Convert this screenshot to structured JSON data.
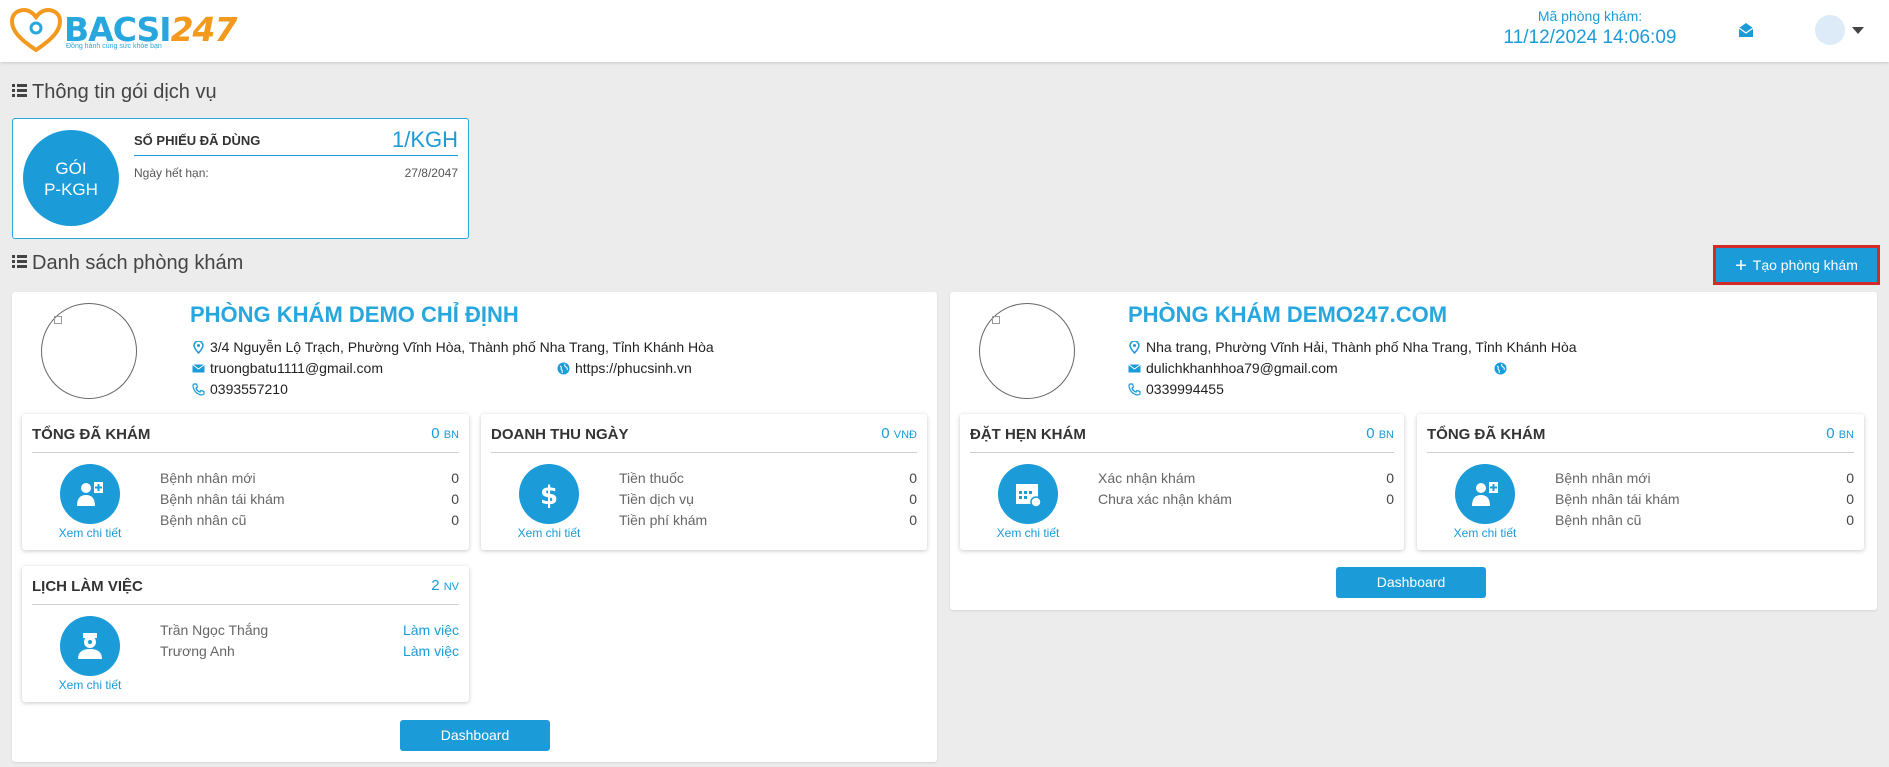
{
  "header": {
    "logo_main": "BACSI",
    "logo_num": "247",
    "logo_slogan": "Đồng hành cùng sức khỏe bạn",
    "clinic_code_label": "Mã phòng khám:",
    "datetime": "11/12/2024 14:06:09"
  },
  "package_section": {
    "title": "Thông tin gói dịch vụ",
    "badge_line1": "GÓI",
    "badge_line2": "P-KGH",
    "used_label": "SỐ PHIẾU ĐÃ DÙNG",
    "used_value": "1/KGH",
    "expiry_label": "Ngày hết hạn:",
    "expiry_value": "27/8/2047"
  },
  "clinic_section": {
    "title": "Danh sách phòng khám",
    "create_button": "Tạo phòng khám"
  },
  "clinics": [
    {
      "name": "PHÒNG KHÁM DEMO CHỈ ĐỊNH",
      "address": "3/4 Nguyễn Lộ Trạch, Phường Vĩnh Hòa, Thành phố Nha Trang, Tỉnh Khánh Hòa",
      "email": "truongbatu1111@gmail.com",
      "website": "https://phucsinh.vn",
      "phone": "0393557210",
      "dashboard_label": "Dashboard",
      "stats": {
        "total_exams": {
          "title": "TỔNG ĐÃ KHÁM",
          "value": "0",
          "unit": "BN",
          "link": "Xem chi tiết",
          "rows": [
            {
              "label": "Bệnh nhân mới",
              "value": "0"
            },
            {
              "label": "Bệnh nhân tái khám",
              "value": "0"
            },
            {
              "label": "Bệnh nhân cũ",
              "value": "0"
            }
          ]
        },
        "daily_revenue": {
          "title": "DOANH THU NGÀY",
          "value": "0",
          "unit": "VNĐ",
          "link": "Xem chi tiết",
          "rows": [
            {
              "label": "Tiền thuốc",
              "value": "0"
            },
            {
              "label": "Tiền dịch vụ",
              "value": "0"
            },
            {
              "label": "Tiền phí khám",
              "value": "0"
            }
          ]
        },
        "work_schedule": {
          "title": "LỊCH LÀM VIỆC",
          "value": "2",
          "unit": "NV",
          "link": "Xem chi tiết",
          "rows": [
            {
              "label": "Trần Ngọc Thắng",
              "value": "Làm việc"
            },
            {
              "label": "Trương Anh",
              "value": "Làm việc"
            }
          ]
        }
      }
    },
    {
      "name": "PHÒNG KHÁM DEMO247.COM",
      "address": "Nha trang, Phường Vĩnh Hải, Thành phố Nha Trang, Tỉnh Khánh Hòa",
      "email": "dulichkhanhhoa79@gmail.com",
      "website": "",
      "phone": "0339994455",
      "dashboard_label": "Dashboard",
      "stats": {
        "appointments": {
          "title": "ĐẶT HẸN KHÁM",
          "value": "0",
          "unit": "BN",
          "link": "Xem chi tiết",
          "rows": [
            {
              "label": "Xác nhận khám",
              "value": "0"
            },
            {
              "label": "Chưa xác nhận khám",
              "value": "0"
            }
          ]
        },
        "total_exams": {
          "title": "TỔNG ĐÃ KHÁM",
          "value": "0",
          "unit": "BN",
          "link": "Xem chi tiết",
          "rows": [
            {
              "label": "Bệnh nhân mới",
              "value": "0"
            },
            {
              "label": "Bệnh nhân tái khám",
              "value": "0"
            },
            {
              "label": "Bệnh nhân cũ",
              "value": "0"
            }
          ]
        }
      }
    }
  ],
  "icons": {
    "header": [
      "heart-logo-icon",
      "mail-icon",
      "avatar-icon",
      "caret-down-icon"
    ],
    "section": "list-icon",
    "contact": [
      "map-pin-icon",
      "email-icon",
      "globe-icon",
      "phone-icon"
    ],
    "stats": [
      "doctor-patient-icon",
      "dollar-icon",
      "calendar-icon",
      "nurse-icon"
    ]
  },
  "colors": {
    "primary": "#1b9bd7",
    "brand_orange": "#f39a1e",
    "highlight_border": "#d32a2a",
    "background": "#ececec"
  }
}
